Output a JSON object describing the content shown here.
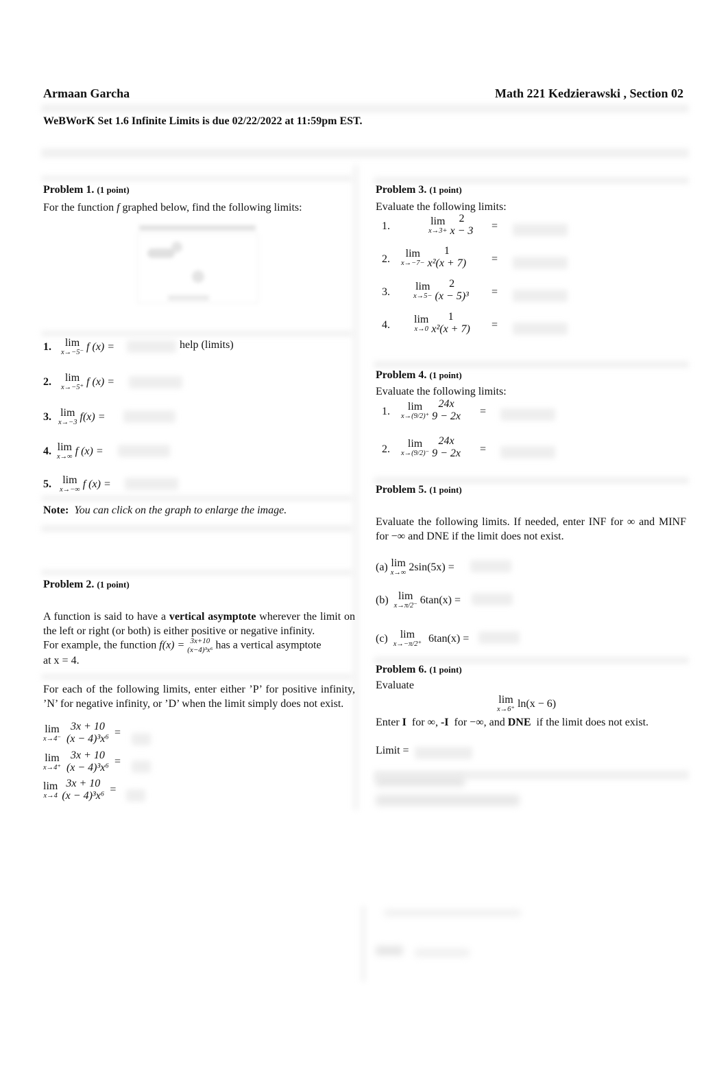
{
  "header": {
    "student_name": "Armaan Garcha",
    "course": "Math 221  Kedzierawski , Section 02",
    "set_line": "WeBWorK Set 1.6  Infinite Limits is due 02/22/2022 at 11:59pm EST."
  },
  "problems": {
    "p1": {
      "title": "Problem 1.",
      "points": "(1 point)",
      "prompt_pre": "For the function ",
      "prompt_var": "f",
      "prompt_post": " graphed below, find the following limits:",
      "graph_alt": "graph of f (blurred)",
      "items": [
        {
          "num": "1.",
          "sub": "x→−5⁻",
          "expr": "f (x) =",
          "answer": ""
        },
        {
          "num": "2.",
          "sub": "x→−5⁺",
          "expr": "f (x) =",
          "answer": ""
        },
        {
          "num": "3.",
          "sub": "x→−3",
          "expr": "f(x) =",
          "answer": ""
        },
        {
          "num": "4.",
          "sub": "x→∞",
          "expr": "f (x) =",
          "answer": ""
        },
        {
          "num": "5.",
          "sub": "x→−∞",
          "expr": "f (x) =",
          "answer": ""
        }
      ],
      "help_link": "help (limits)",
      "note_label": "Note:",
      "note_text": "You can click on the graph to enlarge the image."
    },
    "p2": {
      "title": "Problem 2.",
      "points": "(1 point)",
      "intro_pre": "A function is said to have a ",
      "intro_bold": "vertical asymptote",
      "intro_post": "  wherever the limit on the left or right (or both) is either positive or negative infinity.",
      "example_pre": "For example, the function ",
      "example_fx": "f(x) =",
      "example_num": "3x+10",
      "example_den": "(x−4)³x⁶",
      "example_post": " has a vertical asymptote",
      "example_at": "at x = 4.",
      "instructions": "For each of the following limits, enter either ’P’ for positive infinity, ’N’ for negative infinity, or ’D’ when the limit simply does not exist.",
      "items": [
        {
          "sub": "x→4⁻",
          "num": "3x + 10",
          "den": "(x − 4)³x⁶",
          "answer": ""
        },
        {
          "sub": "x→4⁺",
          "num": "3x + 10",
          "den": "(x − 4)³x⁶",
          "answer": ""
        },
        {
          "sub": "x→4",
          "num": "3x + 10",
          "den": "(x − 4)³x⁶",
          "answer": ""
        }
      ]
    },
    "p3": {
      "title": "Problem 3.",
      "points": "(1 point)",
      "prompt": "Evaluate the following limits:",
      "items": [
        {
          "num": "1.",
          "sub": "x→3+",
          "fnum": "2",
          "fden": "x − 3",
          "answer": ""
        },
        {
          "num": "2.",
          "sub": "x→−7−",
          "fnum": "1",
          "fden": "x²(x + 7)",
          "answer": ""
        },
        {
          "num": "3.",
          "sub": "x→5−",
          "fnum": "2",
          "fden": "(x − 5)³",
          "answer": ""
        },
        {
          "num": "4.",
          "sub": "x→0",
          "fnum": "1",
          "fden": "x²(x + 7)",
          "answer": ""
        }
      ]
    },
    "p4": {
      "title": "Problem 4.",
      "points": "(1 point)",
      "prompt": "Evaluate the following limits:",
      "items": [
        {
          "num": "1.",
          "sub": "x→(9/2)⁺",
          "fnum": "24x",
          "fden": "9 − 2x",
          "answer": ""
        },
        {
          "num": "2.",
          "sub": "x→(9/2)⁻",
          "fnum": "24x",
          "fden": "9 − 2x",
          "answer": ""
        }
      ]
    },
    "p5": {
      "title": "Problem 5.",
      "points": "(1 point)",
      "prompt": "Evaluate the following limits.  If needed, enter INF for ∞ and MINF for −∞ and DNE if the limit does not exist.",
      "items": [
        {
          "label": "(a)",
          "sub": "x→∞",
          "expr": "2sin(5x) =",
          "answer": ""
        },
        {
          "label": "(b)",
          "sub": "x→π/2⁻",
          "expr": "6tan(x) =",
          "answer": ""
        },
        {
          "label": "(c)",
          "sub": "x→−π/2⁺",
          "expr": "6tan(x) =",
          "answer": ""
        }
      ]
    },
    "p6": {
      "title": "Problem 6.",
      "points": "(1 point)",
      "prompt": "Evaluate",
      "lim_sub": "x→6⁺",
      "lim_expr": "ln(x − 6)",
      "enter_pre": "Enter ",
      "enter_i": "I",
      "enter_mid1": "  for ∞, ",
      "enter_neg_i": "-I",
      "enter_mid2": "  for −∞, and ",
      "enter_dne": "DNE",
      "enter_post": "  if the limit does not exist.",
      "limit_label": "Limit =",
      "answer": ""
    }
  },
  "lim_word": "lim",
  "equals": "="
}
